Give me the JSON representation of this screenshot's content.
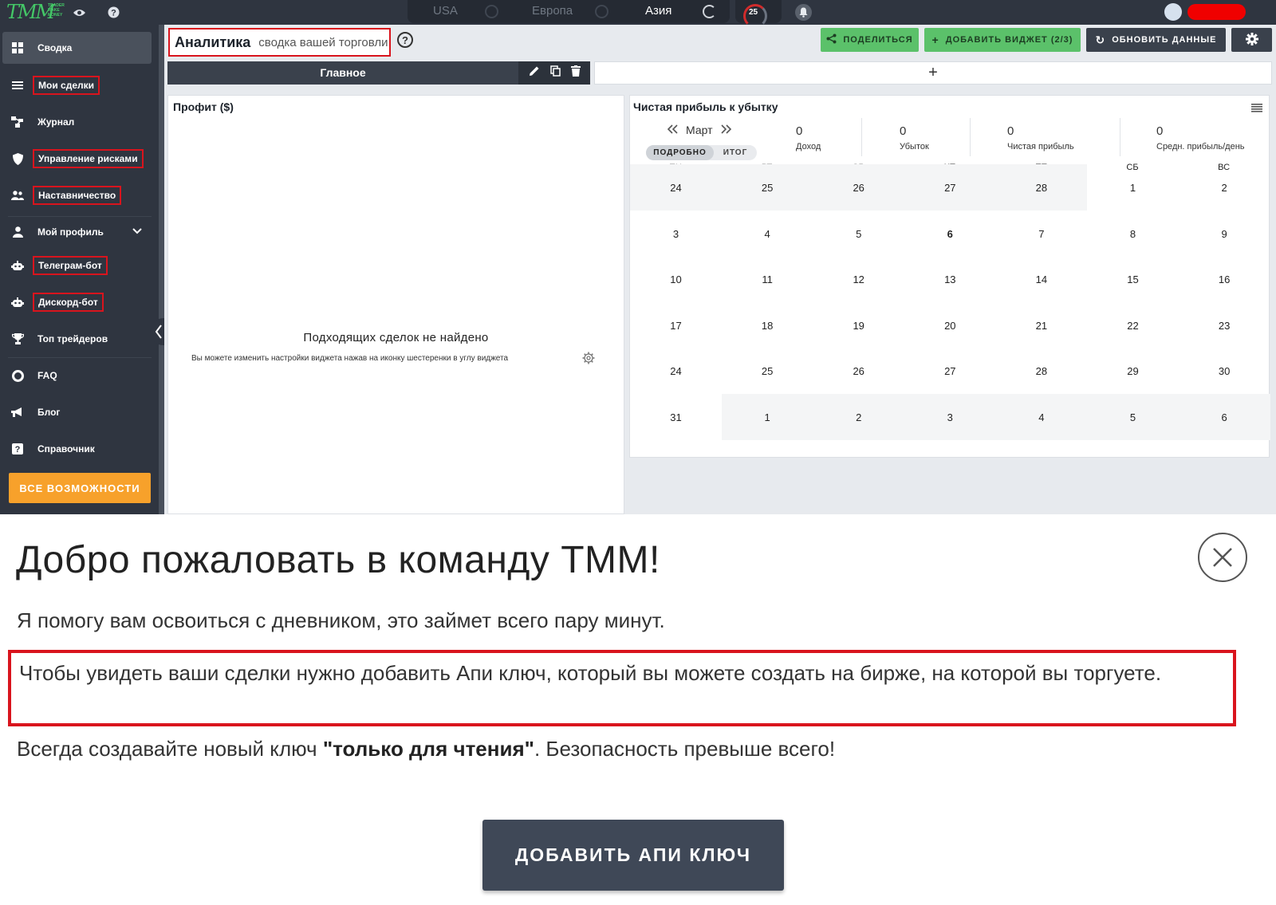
{
  "topbar": {
    "logo_text": "TMM",
    "logo_small": "TRADER MAKE MONEY",
    "markets": [
      {
        "label": "USA",
        "active": false
      },
      {
        "label": "Европа",
        "active": false
      },
      {
        "label": "Азия",
        "active": true
      }
    ],
    "gauge_value": "25"
  },
  "sidebar": {
    "items": [
      {
        "label": "Сводка",
        "icon": "dashboard-icon"
      },
      {
        "label": "Мои сделки",
        "icon": "list-icon"
      },
      {
        "label": "Журнал",
        "icon": "journal-icon"
      },
      {
        "label": "Управление рисками",
        "icon": "shield-icon"
      },
      {
        "label": "Наставничество",
        "icon": "people-icon"
      },
      {
        "label": "Мой профиль",
        "icon": "user-icon"
      },
      {
        "label": "Телеграм-бот",
        "icon": "robot-icon"
      },
      {
        "label": "Дискорд-бот",
        "icon": "robot-icon"
      },
      {
        "label": "Топ трейдеров",
        "icon": "trophy-icon"
      },
      {
        "label": "FAQ",
        "icon": "lifebuoy-icon"
      },
      {
        "label": "Блог",
        "icon": "megaphone-icon"
      },
      {
        "label": "Справочник",
        "icon": "question-icon"
      }
    ],
    "all_features": "ВСЕ ВОЗМОЖНОСТИ"
  },
  "header": {
    "title": "Аналитика",
    "subtitle": "сводка вашей торговли",
    "share": "ПОДЕЛИТЬСЯ",
    "add_widget": "ДОБАВИТЬ ВИДЖЕТ (2/3)",
    "refresh": "ОБНОВИТЬ ДАННЫЕ"
  },
  "tabs": {
    "main": "Главное",
    "add": "+"
  },
  "profit_widget": {
    "title": "Профит ($)",
    "empty_title": "Подходящих сделок не найдено",
    "empty_sub": "Вы можете изменить настройки виджета нажав на иконку шестеренки в углу виджета"
  },
  "calendar_widget": {
    "title": "Чистая прибыль к убытку",
    "month": "Март",
    "toggle_on": "ПОДРОБНО",
    "toggle_off": "ИТОГ",
    "stats": [
      {
        "value": "0",
        "label": "Доход"
      },
      {
        "value": "0",
        "label": "Убыток"
      },
      {
        "value": "0",
        "label": "Чистая прибыль"
      },
      {
        "value": "0",
        "label": "Средн. прибыль/день"
      }
    ],
    "weekdays": [
      "ПН",
      "ВТ",
      "СР",
      "ЧТ",
      "ПТ",
      "СБ",
      "ВС"
    ],
    "weeks": [
      [
        "24",
        "25",
        "26",
        "27",
        "28",
        "1",
        "2"
      ],
      [
        "3",
        "4",
        "5",
        "6",
        "7",
        "8",
        "9"
      ],
      [
        "10",
        "11",
        "12",
        "13",
        "14",
        "15",
        "16"
      ],
      [
        "17",
        "18",
        "19",
        "20",
        "21",
        "22",
        "23"
      ],
      [
        "24",
        "25",
        "26",
        "27",
        "28",
        "29",
        "30"
      ],
      [
        "31",
        "1",
        "2",
        "3",
        "4",
        "5",
        "6"
      ]
    ],
    "today": "6"
  },
  "modal": {
    "title": "Добро пожаловать в команду TMM!",
    "p1": "Я помогу вам освоиться с дневником, это займет всего пару минут.",
    "p2": "Чтобы увидеть ваши сделки нужно добавить Апи ключ, который вы можете создать на бирже, на которой вы торгуете.",
    "p3_before": "Всегда создавайте новый ключ ",
    "p3_bold": "\"только для чтения\"",
    "p3_after": ". Безопасность превыше всего!",
    "button": "ДОБАВИТЬ АПИ КЛЮЧ"
  },
  "colors": {
    "sidebar_bg": "#2f3540",
    "accent_orange": "#f7a12b",
    "accent_green": "#5bc16a",
    "highlight_red": "#d9141d"
  }
}
